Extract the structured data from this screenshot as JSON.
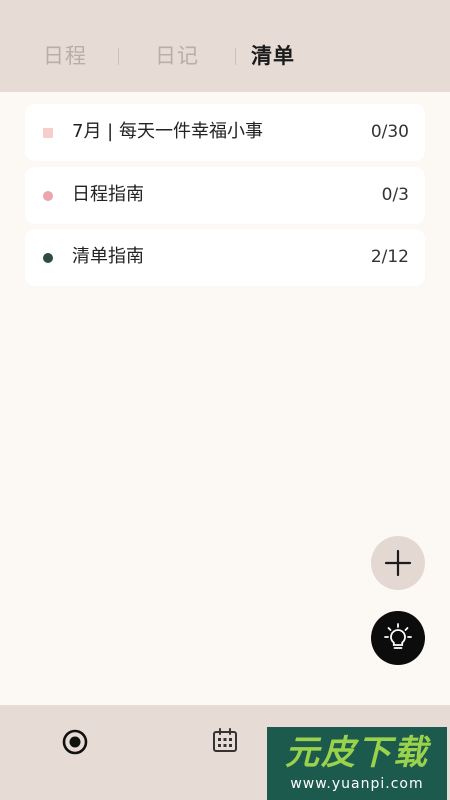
{
  "tabs": [
    {
      "label": "日程",
      "active": false
    },
    {
      "label": "日记",
      "active": false
    },
    {
      "label": "清单",
      "active": true
    }
  ],
  "lists": [
    {
      "title": "7月 | 每天一件幸福小事",
      "count": "0/30",
      "marker": "square",
      "color": "#f6cfcc"
    },
    {
      "title": "日程指南",
      "count": "0/3",
      "marker": "dot",
      "color": "#eba6ad"
    },
    {
      "title": "清单指南",
      "count": "2/12",
      "marker": "dot",
      "color": "#2f4a43"
    }
  ],
  "fab": {
    "add_icon": "plus-icon",
    "idea_icon": "lightbulb-icon"
  },
  "bottom_nav": [
    {
      "icon": "record-icon"
    },
    {
      "icon": "calendar-icon"
    },
    {
      "icon": "profile-icon"
    }
  ],
  "watermark": {
    "main": "元皮下载",
    "sub": "www.yuanpi.com"
  },
  "colors": {
    "background": "#fcf8f3",
    "header": "#e6dbd5",
    "active_tab": "#1b1b1b",
    "inactive_tab": "#b9aea8"
  }
}
